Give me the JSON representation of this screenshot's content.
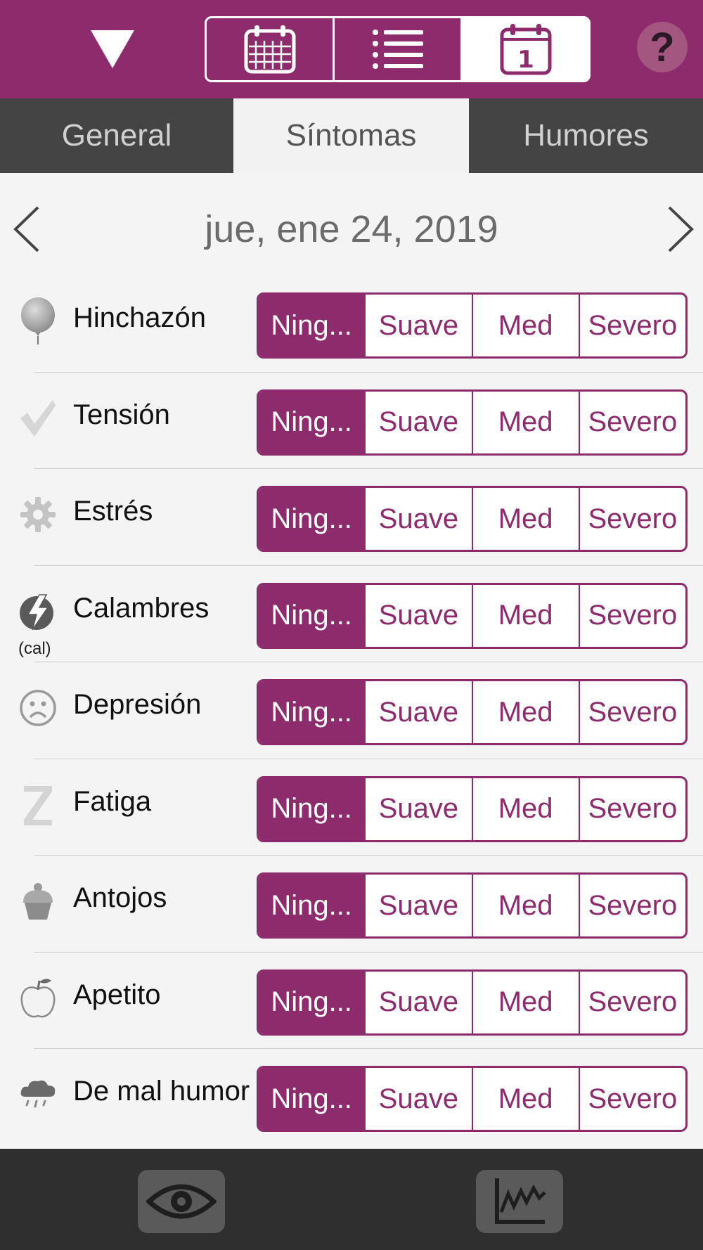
{
  "colors": {
    "accent": "#8e2b6c",
    "tab_bar": "#444444",
    "bottom_bar": "#2f2f2f"
  },
  "tabs": [
    {
      "label": "General",
      "active": false
    },
    {
      "label": "Síntomas",
      "active": true
    },
    {
      "label": "Humores",
      "active": false
    }
  ],
  "view_switcher": {
    "options": [
      "month-calendar-icon",
      "list-icon",
      "day-calendar-icon"
    ],
    "active_index": 2,
    "day_number": "1"
  },
  "help_label": "?",
  "date": "jue, ene 24, 2019",
  "severity_options": [
    "Ning...",
    "Suave",
    "Med",
    "Severo"
  ],
  "symptoms": [
    {
      "label": "Hinchazón",
      "icon": "balloon-icon",
      "selected": 0
    },
    {
      "label": "Tensión",
      "icon": "checkmark-icon",
      "selected": 0
    },
    {
      "label": "Estrés",
      "icon": "gear-icon",
      "selected": 0
    },
    {
      "label": "Calambres",
      "icon": "lightning-icon",
      "sublabel": "(cal)",
      "selected": 0
    },
    {
      "label": "Depresión",
      "icon": "sad-face-icon",
      "selected": 0
    },
    {
      "label": "Fatiga",
      "icon": "sleep-z-icon",
      "selected": 0
    },
    {
      "label": "Antojos",
      "icon": "cupcake-icon",
      "selected": 0
    },
    {
      "label": "Apetito",
      "icon": "apple-icon",
      "selected": 0
    },
    {
      "label": "De mal humor",
      "icon": "storm-cloud-icon",
      "selected": 0
    }
  ],
  "bottom_buttons": [
    "eye-icon",
    "chart-icon"
  ]
}
